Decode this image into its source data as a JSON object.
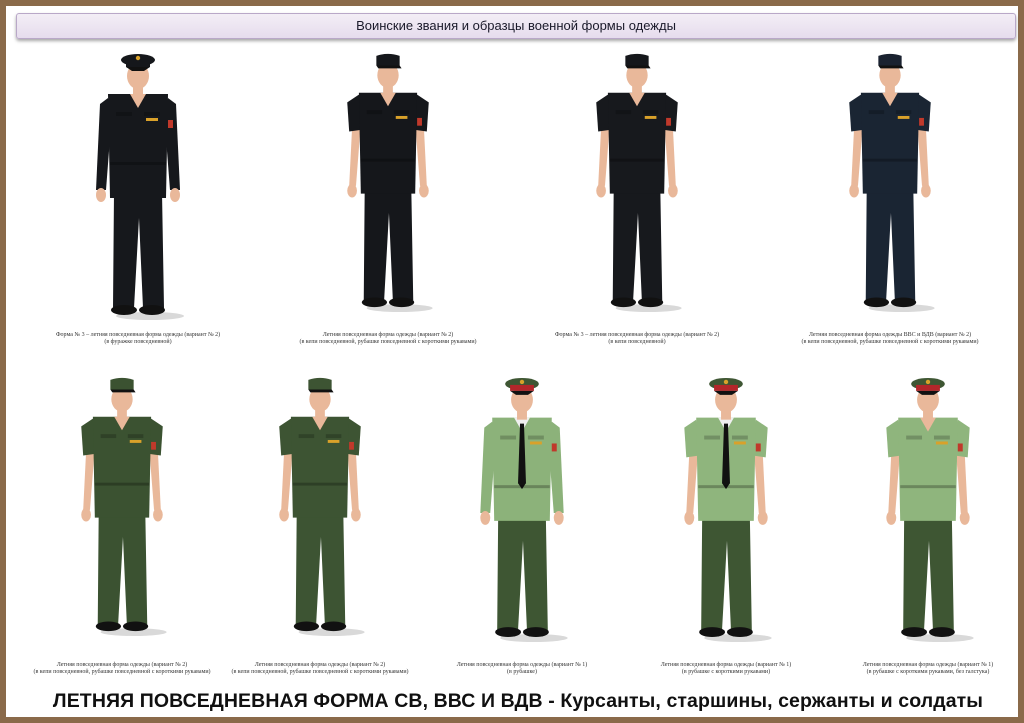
{
  "header": {
    "title": "Воинские звания и образцы военной формы одежды"
  },
  "row_top": [
    {
      "caption_l1": "Форма № 3 – летняя повседневная форма одежды (вариант № 2)",
      "caption_l2": "(в фуражке повседневной)",
      "uniform": "navy-jacket",
      "colors": {
        "cloth": "#16181c",
        "cap": "#15171b",
        "band": "#15171b",
        "shirt": "#16181c"
      }
    },
    {
      "caption_l1": "Летняя повседневная форма одежды (вариант № 2)",
      "caption_l2": "(в кепи повседневной, рубашке повседневной с короткими рукавами)",
      "uniform": "navy-shortsleeve",
      "colors": {
        "cloth": "#15171b",
        "cap": "#15171b",
        "band": "#15171b",
        "shirt": "#15171b"
      }
    },
    {
      "caption_l1": "Форма № 3 – летняя повседневная форма одежды (вариант № 2)",
      "caption_l2": "(в кепи повседневной)",
      "uniform": "navy-shortsleeve",
      "colors": {
        "cloth": "#17191d",
        "cap": "#15171b",
        "band": "#15171b",
        "shirt": "#17191d"
      }
    },
    {
      "caption_l1": "Летняя повседневная форма одежды ВВС и ВДВ (вариант № 2)",
      "caption_l2": "(в кепи повседневной, рубашке повседневной с короткими рукавами)",
      "uniform": "darkblue-shortsleeve",
      "colors": {
        "cloth": "#1a2533",
        "cap": "#1a2230",
        "band": "#1a2230",
        "shirt": "#1a2533"
      }
    }
  ],
  "row_bottom": [
    {
      "caption_l1": "Летняя повседневная форма одежды (вариант № 2)",
      "caption_l2": "(в кепи повседневной, рубашке повседневной с короткими рукавами)",
      "uniform": "olive-shortsleeve",
      "colors": {
        "cloth": "#3b5231",
        "cap": "#3b5231",
        "band": "#3b5231",
        "shirt": "#3b5231"
      }
    },
    {
      "caption_l1": "Летняя повседневная форма одежды (вариант № 2)",
      "caption_l2": "(в кепи повседневной, рубашке повседневной с короткими рукавами)",
      "uniform": "olive-shortsleeve",
      "colors": {
        "cloth": "#3d5433",
        "cap": "#3d5433",
        "band": "#3d5433",
        "shirt": "#3d5433"
      }
    },
    {
      "caption_l1": "Летняя повседневная форма одежды (вариант № 1)",
      "caption_l2": "(в рубашке)",
      "uniform": "lightgreen-longsleeve-tie",
      "colors": {
        "cloth": "#3e5633",
        "cap": "#3e5633",
        "band": "#b3262a",
        "shirt": "#8cb27a"
      }
    },
    {
      "caption_l1": "Летняя повседневная форма одежды (вариант № 1)",
      "caption_l2": "(в рубашке с короткими рукавами)",
      "uniform": "lightgreen-shortsleeve-tie",
      "colors": {
        "cloth": "#3e5633",
        "cap": "#3e5633",
        "band": "#b3262a",
        "shirt": "#8fb57d"
      }
    },
    {
      "caption_l1": "Летняя повседневная форма одежды (вариант № 1)",
      "caption_l2": "(в рубашке с короткими рукавами, без галстука)",
      "uniform": "lightgreen-shortsleeve",
      "colors": {
        "cloth": "#3e5633",
        "cap": "#3e5633",
        "band": "#b3262a",
        "shirt": "#8fb57d"
      }
    }
  ],
  "footer": {
    "title": "ЛЕТНЯЯ  ПОВСЕДНЕВНАЯ ФОРМА СВ, ВВС  И ВДВ - Курсанты, старшины, сержанты и солдаты"
  },
  "colors": {
    "frame": "#8a6a4a",
    "skin": "#e9b89a",
    "boot": "#111111"
  }
}
